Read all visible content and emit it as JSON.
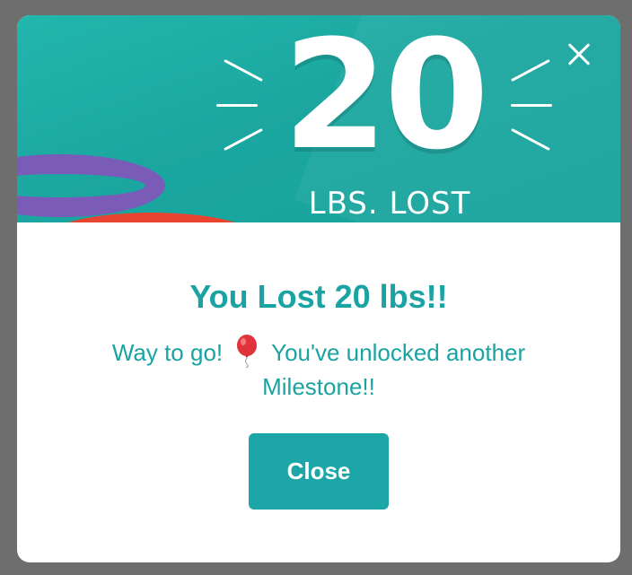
{
  "hero": {
    "number": "20",
    "caption": "LBS. LOST"
  },
  "icons": {
    "close": "close-icon",
    "balloon": "balloon-icon"
  },
  "modal": {
    "title": "You Lost 20 lbs!!",
    "message_before_icon": "Way to go!",
    "message_after_icon": "You've unlocked another Milestone!!",
    "button_label": "Close"
  },
  "colors": {
    "accent": "#1aa3a2",
    "hero_bg": "#1ba7a0",
    "band_purple": "#7a5bb8",
    "band_red": "#e8442f",
    "backdrop": "#6e6e6e"
  }
}
